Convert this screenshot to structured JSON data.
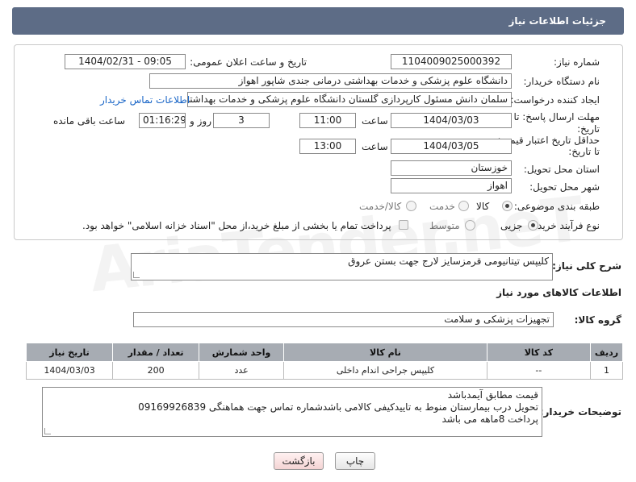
{
  "header": {
    "title": "جزئیات اطلاعات نیاز"
  },
  "fields": {
    "need_number": {
      "label": "شماره نیاز:",
      "value": "1104009025000392"
    },
    "announce_datetime": {
      "label": "تاریخ و ساعت اعلان عمومی:",
      "value": "1404/02/31 - 09:05"
    },
    "buyer_org": {
      "label": "نام دستگاه خریدار:",
      "value": "دانشگاه علوم پزشکی و خدمات بهداشتی درمانی جندی شاپور اهواز"
    },
    "requester": {
      "label": "ایجاد کننده درخواست:",
      "value": "سلمان دانش مسئول کارپردازی گلستان دانشگاه علوم پزشکی و خدمات بهداشتی",
      "link": "اطلاعات تماس خریدار"
    },
    "reply_deadline": {
      "label_line1": "مهلت ارسال پاسخ: تا",
      "label_line2": "تاریخ:",
      "date": "1404/03/03",
      "time_label": "ساعت",
      "time": "11:00",
      "days": "3",
      "days_label": "روز و",
      "remaining": "01:16:29",
      "remaining_label": "ساعت باقی مانده"
    },
    "price_validity": {
      "label_line1": "حداقل تاریخ اعتبار قیمت:",
      "label_line2": "تا تاریخ:",
      "date": "1404/03/05",
      "time_label": "ساعت",
      "time": "13:00"
    },
    "delivery_province": {
      "label": "استان محل تحویل:",
      "value": "خوزستان"
    },
    "delivery_city": {
      "label": "شهر محل تحویل:",
      "value": "اهواز"
    },
    "category": {
      "label": "طبقه بندی موضوعی:",
      "options": [
        "کالا",
        "خدمت",
        "کالا/خدمت"
      ],
      "selected": "کالا"
    },
    "purchase_type": {
      "label": "نوع فرآیند خرید :",
      "options": [
        "جزیی",
        "متوسط"
      ],
      "selected": "جزیی",
      "note": "پرداخت تمام یا بخشی از مبلغ خرید،از محل \"اسناد خزانه اسلامی\" خواهد بود."
    }
  },
  "description": {
    "label": "شرح کلی نیاز:",
    "value": "کلیپس تیتانیومی قرمزسایز لارج جهت بستن عروق"
  },
  "goods_section": {
    "title": "اطلاعات کالاهای مورد نیاز"
  },
  "goods_group": {
    "label": "گروه کالا:",
    "value": "تجهیزات پزشکی و سلامت"
  },
  "table": {
    "headers": [
      "ردیف",
      "کد کالا",
      "نام کالا",
      "واحد شمارش",
      "تعداد / مقدار",
      "تاریخ نیاز"
    ],
    "rows": [
      [
        "1",
        "--",
        "کلیپس جراحی اندام داخلی",
        "عدد",
        "200",
        "1404/03/03"
      ]
    ]
  },
  "buyer_notes": {
    "label": "توضیحات خریدار:",
    "lines": [
      "قیمت مطابق آیمدباشد",
      "تحویل درب بیمارستان منوط به تاییدکیفی کالامی باشدشماره تماس جهت هماهنگی 09169926839",
      "پرداخت 8ماهه می باشد"
    ]
  },
  "buttons": {
    "print": "چاپ",
    "back": "بازگشت"
  },
  "watermark": "AriaTender.neT"
}
